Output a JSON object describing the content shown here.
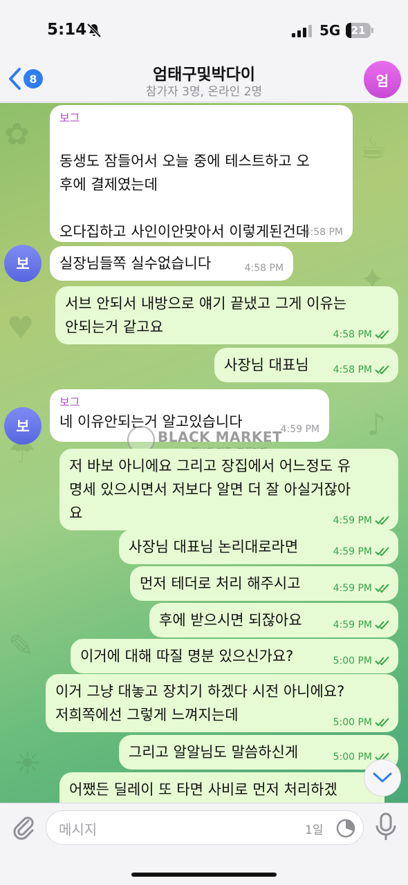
{
  "status_bar": {
    "time": "5:14",
    "network": "5G",
    "battery": "21"
  },
  "header": {
    "back_badge": "8",
    "title": "엄태구및박다이",
    "subtitle": "참가자 3명, 온라인 2명",
    "avatar_initial": "엄"
  },
  "messages": [
    {
      "direction": "in",
      "sender": "보그",
      "text": "동생도 잠들어서 오늘 중에 테스트하고 오\n후에 결제였는데\n\n오다집하고 사인이안맞아서 이렇게된건데",
      "time": "4:58 PM"
    },
    {
      "direction": "in",
      "avatar": "보",
      "text": "실장님들쪽 실수없습니다",
      "time": "4:58 PM"
    },
    {
      "direction": "out",
      "text": "서브 안되서 내방으로 얘기 끝냈고 그게 이유는\n안되는거 같고요",
      "time": "4:58 PM"
    },
    {
      "direction": "out",
      "text": "사장님 대표님",
      "time": "4:58 PM"
    },
    {
      "direction": "in",
      "sender": "보그",
      "avatar": "보",
      "text": "네 이유안되는거 알고있습니다",
      "time": "4:59 PM"
    },
    {
      "direction": "out",
      "text": "저 바보 아니에요 그리고 장집에서 어느정도 유\n명세 있으시면서 저보다 알면 더 잘 아실거잖아\n요",
      "time": "4:59 PM"
    },
    {
      "direction": "out",
      "text": "사장님 대표님 논리대로라면",
      "time": "4:59 PM"
    },
    {
      "direction": "out",
      "text": "먼저 테더로 처리 해주시고",
      "time": "4:59 PM"
    },
    {
      "direction": "out",
      "text": "후에 받으시면 되잖아요",
      "time": "4:59 PM"
    },
    {
      "direction": "out",
      "text": "이거에 대해 따질 명분 있으신가요?",
      "time": "5:00 PM"
    },
    {
      "direction": "out",
      "text": "이거 그냥 대놓고 장치기 하겠다 시전 아니에요?\n저희쪽에선 그렇게 느껴지는데",
      "time": "5:00 PM"
    },
    {
      "direction": "out",
      "text": "그리고 알알님도 말씀하신게",
      "time": "5:00 PM"
    },
    {
      "direction": "out",
      "text": "어쨌든 딜레이 또 타면 사비로 먼저 처리하겠",
      "time": ""
    }
  ],
  "watermark": {
    "title": "BLACK MARKET",
    "subtitle": "정보의 기준, 블랙마켓"
  },
  "input": {
    "placeholder": "메시지",
    "timer_label": "1일"
  },
  "icons": {
    "bell": "bell-slash-icon",
    "back": "chevron-left-icon",
    "attach": "paperclip-icon",
    "timer": "timer-icon",
    "mic": "microphone-icon",
    "scroll": "chevron-down-icon"
  },
  "colors": {
    "accent": "#2e7ef0",
    "sender_name": "#b44ec6",
    "outgoing_bubble": "#e6fbd3",
    "outgoing_time": "#37a34a",
    "group_avatar": "#d85bdf",
    "user_avatar": "#6a78ea"
  }
}
